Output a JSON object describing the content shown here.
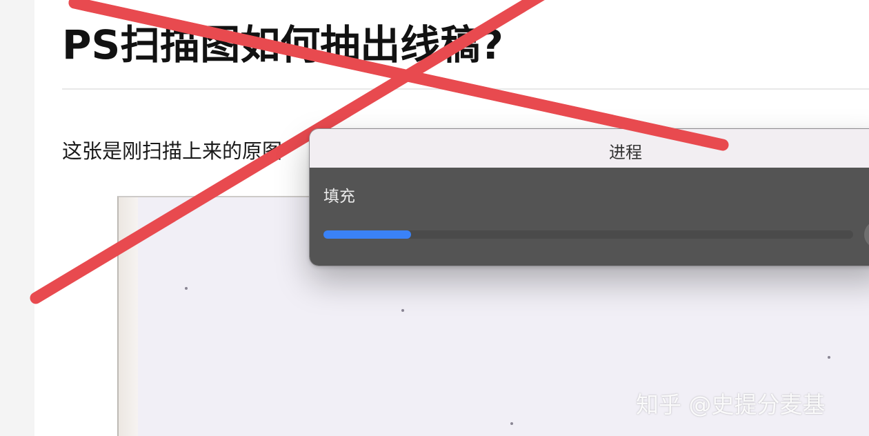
{
  "article": {
    "title": "PS扫描图如何抽出线稿?",
    "paragraph": "这张是刚扫描上来的原图"
  },
  "dialog": {
    "title": "进程",
    "task_label": "填充",
    "progress_fraction": 0.165
  },
  "watermark": "知乎 @史提分麦基",
  "colors": {
    "strike": "#e84a4f",
    "progress": "#3a82f7",
    "dialog_body": "#545454"
  }
}
